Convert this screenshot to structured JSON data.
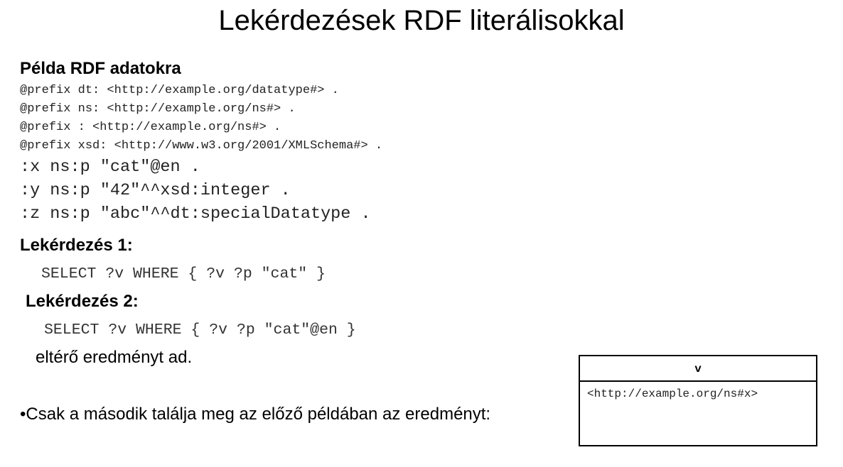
{
  "title": "Lekérdezések RDF literálisokkal",
  "example_heading": "Példa RDF adatokra",
  "prefixes": [
    "@prefix dt: <http://example.org/datatype#> .",
    "@prefix ns: <http://example.org/ns#> .",
    "@prefix : <http://example.org/ns#> .",
    "@prefix xsd: <http://www.w3.org/2001/XMLSchema#> ."
  ],
  "triples": [
    ":x ns:p \"cat\"@en .",
    ":y ns:p \"42\"^^xsd:integer .",
    ":z ns:p \"abc\"^^dt:specialDatatype ."
  ],
  "query1": {
    "heading": "Lekérdezés 1:",
    "code": "SELECT ?v WHERE { ?v ?p \"cat\" }"
  },
  "query2": {
    "heading": "Lekérdezés 2:",
    "code": "SELECT ?v WHERE { ?v ?p \"cat\"@en }"
  },
  "different_result": "eltérő eredményt ad.",
  "bullet_text": "•Csak a második találja meg az előző példában az eredményt:",
  "result_table": {
    "header": "v",
    "rows": [
      "<http://example.org/ns#x>"
    ]
  }
}
